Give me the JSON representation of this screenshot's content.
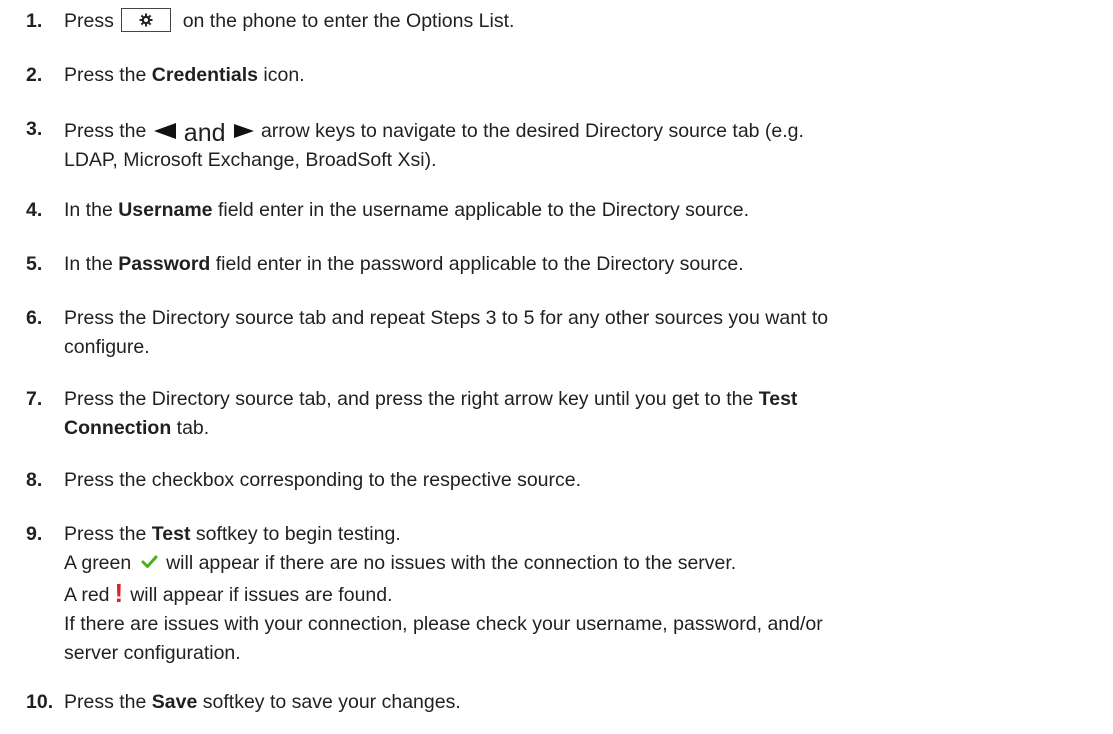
{
  "colors": {
    "text": "#231f20",
    "check": "#4caf1a",
    "warning": "#e51d25"
  },
  "icons": [
    "gear-key-icon",
    "left-arrow-icon",
    "right-arrow-icon",
    "green-check-icon",
    "red-exclamation-icon"
  ],
  "steps": [
    {
      "num": "1.",
      "pre": "Press",
      "post": "on the phone to enter the Options List."
    },
    {
      "num": "2.",
      "pre": "Press the ",
      "bold": "Credentials",
      "post": " icon."
    },
    {
      "num": "3.",
      "pre": "Press the",
      "and": "and",
      "post": "arrow keys to navigate to the desired Directory source tab (e.g.",
      "line2": "LDAP, Microsoft Exchange, BroadSoft Xsi)."
    },
    {
      "num": "4.",
      "pre": "In the ",
      "bold": "Username",
      "post": " field enter in the username applicable to the Directory source."
    },
    {
      "num": "5.",
      "pre": "In the ",
      "bold": "Password",
      "post": " field enter in the password applicable to the Directory source."
    },
    {
      "num": "6.",
      "line1": "Press the Directory source tab and repeat Steps 3 to 5 for any other sources you want to",
      "line2": "configure."
    },
    {
      "num": "7.",
      "pre": "Press the Directory source tab, and press the right arrow key until you get to the ",
      "bold": "Test",
      "bold2": "Connection",
      "post": " tab."
    },
    {
      "num": "8.",
      "line1": "Press the checkbox corresponding to the respective source."
    },
    {
      "num": "9.",
      "pre": "Press the ",
      "bold": "Test",
      "post": " softkey to begin testing.",
      "green_pre": "A green",
      "green_post": "will appear if there are no issues with the connection to the server.",
      "red_pre": "A red",
      "red_mark": "!",
      "red_post": "will appear if issues are found.",
      "issue_line1": "If there are issues with your connection, please check your username, password, and/or",
      "issue_line2": "server configuration."
    },
    {
      "num": "10.",
      "pre": "Press the ",
      "bold": "Save",
      "post": " softkey to save your changes."
    }
  ]
}
